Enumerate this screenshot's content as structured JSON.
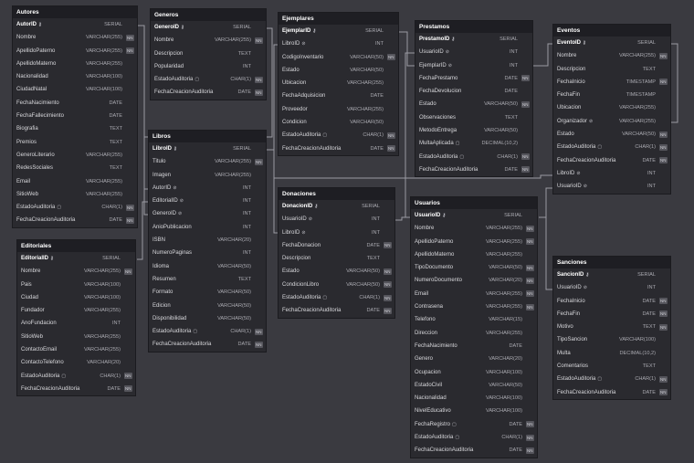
{
  "tables": [
    {
      "id": "autores",
      "title": "Autores",
      "cols": [
        {
          "n": "AutorID",
          "t": "SERIAL",
          "pk": true,
          "icon": "key-icon"
        },
        {
          "n": "Nombre",
          "t": "VARCHAR(255)",
          "nn": true
        },
        {
          "n": "ApellidoPaterno",
          "t": "VARCHAR(255)",
          "nn": true
        },
        {
          "n": "ApellidoMaterno",
          "t": "VARCHAR(255)"
        },
        {
          "n": "Nacionalidad",
          "t": "VARCHAR(100)"
        },
        {
          "n": "CiudadNatal",
          "t": "VARCHAR(100)"
        },
        {
          "n": "FechaNacimiento",
          "t": "DATE"
        },
        {
          "n": "FechaFallecimiento",
          "t": "DATE"
        },
        {
          "n": "Biografia",
          "t": "TEXT"
        },
        {
          "n": "Premios",
          "t": "TEXT"
        },
        {
          "n": "GeneroLiterario",
          "t": "VARCHAR(255)"
        },
        {
          "n": "RedesSociales",
          "t": "TEXT"
        },
        {
          "n": "Email",
          "t": "VARCHAR(255)"
        },
        {
          "n": "SitioWeb",
          "t": "VARCHAR(255)"
        },
        {
          "n": "EstadoAuditoria",
          "t": "CHAR(1)",
          "nn": true,
          "icon": "note-icon"
        },
        {
          "n": "FechaCreacionAuditoria",
          "t": "DATE",
          "nn": true
        }
      ]
    },
    {
      "id": "editoriales",
      "title": "Editoriales",
      "cols": [
        {
          "n": "EditorialID",
          "t": "SERIAL",
          "pk": true,
          "icon": "key-icon"
        },
        {
          "n": "Nombre",
          "t": "VARCHAR(255)",
          "nn": true
        },
        {
          "n": "Pais",
          "t": "VARCHAR(100)"
        },
        {
          "n": "Ciudad",
          "t": "VARCHAR(100)"
        },
        {
          "n": "Fundador",
          "t": "VARCHAR(255)"
        },
        {
          "n": "AnoFundacion",
          "t": "INT"
        },
        {
          "n": "SitioWeb",
          "t": "VARCHAR(255)"
        },
        {
          "n": "ContactoEmail",
          "t": "VARCHAR(255)"
        },
        {
          "n": "ContactoTelefono",
          "t": "VARCHAR(20)"
        },
        {
          "n": "EstadoAuditoria",
          "t": "CHAR(1)",
          "nn": true,
          "icon": "note-icon"
        },
        {
          "n": "FechaCreacionAuditoria",
          "t": "DATE",
          "nn": true
        }
      ]
    },
    {
      "id": "generos",
      "title": "Generos",
      "cols": [
        {
          "n": "GeneroID",
          "t": "SERIAL",
          "pk": true,
          "icon": "key-icon"
        },
        {
          "n": "Nombre",
          "t": "VARCHAR(255)",
          "nn": true
        },
        {
          "n": "Descripcion",
          "t": "TEXT"
        },
        {
          "n": "Popularidad",
          "t": "INT"
        },
        {
          "n": "EstadoAuditoria",
          "t": "CHAR(1)",
          "nn": true,
          "icon": "note-icon"
        },
        {
          "n": "FechaCreacionAuditoria",
          "t": "DATE",
          "nn": true
        }
      ]
    },
    {
      "id": "libros",
      "title": "Libros",
      "cols": [
        {
          "n": "LibroID",
          "t": "SERIAL",
          "pk": true,
          "icon": "key-icon"
        },
        {
          "n": "Titulo",
          "t": "VARCHAR(255)",
          "nn": true
        },
        {
          "n": "Imagen",
          "t": "VARCHAR(255)"
        },
        {
          "n": "AutorID",
          "t": "INT",
          "icon": "link-icon"
        },
        {
          "n": "EditorialID",
          "t": "INT",
          "icon": "link-icon"
        },
        {
          "n": "GeneroID",
          "t": "INT",
          "icon": "link-icon"
        },
        {
          "n": "AnioPublicacion",
          "t": "INT"
        },
        {
          "n": "ISBN",
          "t": "VARCHAR(20)"
        },
        {
          "n": "NumeroPaginas",
          "t": "INT"
        },
        {
          "n": "Idioma",
          "t": "VARCHAR(50)"
        },
        {
          "n": "Resumen",
          "t": "TEXT"
        },
        {
          "n": "Formato",
          "t": "VARCHAR(50)"
        },
        {
          "n": "Edicion",
          "t": "VARCHAR(50)"
        },
        {
          "n": "Disponibilidad",
          "t": "VARCHAR(50)"
        },
        {
          "n": "EstadoAuditoria",
          "t": "CHAR(1)",
          "nn": true,
          "icon": "note-icon"
        },
        {
          "n": "FechaCreacionAuditoria",
          "t": "DATE",
          "nn": true
        }
      ]
    },
    {
      "id": "ejemplares",
      "title": "Ejemplares",
      "cols": [
        {
          "n": "EjemplarID",
          "t": "SERIAL",
          "pk": true,
          "icon": "key-icon"
        },
        {
          "n": "LibroID",
          "t": "INT",
          "icon": "link-icon"
        },
        {
          "n": "CodigoInventario",
          "t": "VARCHAR(50)",
          "nn": true
        },
        {
          "n": "Estado",
          "t": "VARCHAR(50)"
        },
        {
          "n": "Ubicacion",
          "t": "VARCHAR(255)"
        },
        {
          "n": "FechaAdquisicion",
          "t": "DATE"
        },
        {
          "n": "Proveedor",
          "t": "VARCHAR(255)"
        },
        {
          "n": "Condicion",
          "t": "VARCHAR(50)"
        },
        {
          "n": "EstadoAuditoria",
          "t": "CHAR(1)",
          "nn": true,
          "icon": "note-icon"
        },
        {
          "n": "FechaCreacionAuditoria",
          "t": "DATE",
          "nn": true
        }
      ]
    },
    {
      "id": "donaciones",
      "title": "Donaciones",
      "cols": [
        {
          "n": "DonacionID",
          "t": "SERIAL",
          "pk": true,
          "icon": "key-icon"
        },
        {
          "n": "UsuarioID",
          "t": "INT",
          "icon": "link-icon"
        },
        {
          "n": "LibroID",
          "t": "INT",
          "icon": "link-icon"
        },
        {
          "n": "FechaDonacion",
          "t": "DATE",
          "nn": true
        },
        {
          "n": "Descripcion",
          "t": "TEXT"
        },
        {
          "n": "Estado",
          "t": "VARCHAR(50)",
          "nn": true
        },
        {
          "n": "CondicionLibro",
          "t": "VARCHAR(50)",
          "nn": true
        },
        {
          "n": "EstadoAuditoria",
          "t": "CHAR(1)",
          "nn": true,
          "icon": "note-icon"
        },
        {
          "n": "FechaCreacionAuditoria",
          "t": "DATE",
          "nn": true
        }
      ]
    },
    {
      "id": "prestamos",
      "title": "Prestamos",
      "cols": [
        {
          "n": "PrestamoID",
          "t": "SERIAL",
          "pk": true,
          "icon": "key-icon"
        },
        {
          "n": "UsuarioID",
          "t": "INT",
          "icon": "link-icon"
        },
        {
          "n": "EjemplarID",
          "t": "INT",
          "icon": "link-icon"
        },
        {
          "n": "FechaPrestamo",
          "t": "DATE",
          "nn": true
        },
        {
          "n": "FechaDevolucion",
          "t": "DATE"
        },
        {
          "n": "Estado",
          "t": "VARCHAR(50)",
          "nn": true
        },
        {
          "n": "Observaciones",
          "t": "TEXT"
        },
        {
          "n": "MetodoEntrega",
          "t": "VARCHAR(50)"
        },
        {
          "n": "MultaAplicada",
          "t": "DECIMAL(10,2)",
          "icon": "note-icon"
        },
        {
          "n": "EstadoAuditoria",
          "t": "CHAR(1)",
          "nn": true,
          "icon": "note-icon"
        },
        {
          "n": "FechaCreacionAuditoria",
          "t": "DATE",
          "nn": true
        }
      ]
    },
    {
      "id": "usuarios",
      "title": "Usuarios",
      "cols": [
        {
          "n": "UsuarioID",
          "t": "SERIAL",
          "pk": true,
          "icon": "key-icon"
        },
        {
          "n": "Nombre",
          "t": "VARCHAR(255)",
          "nn": true
        },
        {
          "n": "ApellidoPaterno",
          "t": "VARCHAR(255)",
          "nn": true
        },
        {
          "n": "ApellidoMaterno",
          "t": "VARCHAR(255)"
        },
        {
          "n": "TipoDocumento",
          "t": "VARCHAR(50)",
          "nn": true
        },
        {
          "n": "NumeroDocumento",
          "t": "VARCHAR(20)",
          "nn": true
        },
        {
          "n": "Email",
          "t": "VARCHAR(255)",
          "nn": true
        },
        {
          "n": "Contrasena",
          "t": "VARCHAR(255)",
          "nn": true
        },
        {
          "n": "Telefono",
          "t": "VARCHAR(15)"
        },
        {
          "n": "Direccion",
          "t": "VARCHAR(255)"
        },
        {
          "n": "FechaNacimiento",
          "t": "DATE"
        },
        {
          "n": "Genero",
          "t": "VARCHAR(20)"
        },
        {
          "n": "Ocupacion",
          "t": "VARCHAR(100)"
        },
        {
          "n": "EstadoCivil",
          "t": "VARCHAR(50)"
        },
        {
          "n": "Nacionalidad",
          "t": "VARCHAR(100)"
        },
        {
          "n": "NivelEducativo",
          "t": "VARCHAR(100)"
        },
        {
          "n": "FechaRegistro",
          "t": "DATE",
          "nn": true,
          "icon": "note-icon"
        },
        {
          "n": "EstadoAuditoria",
          "t": "CHAR(1)",
          "nn": true,
          "icon": "note-icon"
        },
        {
          "n": "FechaCreacionAuditoria",
          "t": "DATE",
          "nn": true
        }
      ]
    },
    {
      "id": "eventos",
      "title": "Eventos",
      "cols": [
        {
          "n": "EventoID",
          "t": "SERIAL",
          "pk": true,
          "icon": "key-icon"
        },
        {
          "n": "Nombre",
          "t": "VARCHAR(255)",
          "nn": true
        },
        {
          "n": "Descripcion",
          "t": "TEXT"
        },
        {
          "n": "FechaInicio",
          "t": "TIMESTAMP",
          "nn": true
        },
        {
          "n": "FechaFin",
          "t": "TIMESTAMP"
        },
        {
          "n": "Ubicacion",
          "t": "VARCHAR(255)"
        },
        {
          "n": "Organizador",
          "t": "VARCHAR(255)",
          "icon": "link-icon"
        },
        {
          "n": "Estado",
          "t": "VARCHAR(50)",
          "nn": true
        },
        {
          "n": "EstadoAuditoria",
          "t": "CHAR(1)",
          "nn": true,
          "icon": "note-icon"
        },
        {
          "n": "FechaCreacionAuditoria",
          "t": "DATE",
          "nn": true
        },
        {
          "n": "LibroID",
          "t": "INT",
          "icon": "link-icon"
        },
        {
          "n": "UsuarioID",
          "t": "INT",
          "icon": "link-icon"
        }
      ]
    },
    {
      "id": "sanciones",
      "title": "Sanciones",
      "cols": [
        {
          "n": "SancionID",
          "t": "SERIAL",
          "pk": true,
          "icon": "key-icon"
        },
        {
          "n": "UsuarioID",
          "t": "INT",
          "icon": "link-icon"
        },
        {
          "n": "FechaInicio",
          "t": "DATE",
          "nn": true
        },
        {
          "n": "FechaFin",
          "t": "DATE",
          "nn": true
        },
        {
          "n": "Motivo",
          "t": "TEXT",
          "nn": true
        },
        {
          "n": "TipoSancion",
          "t": "VARCHAR(100)"
        },
        {
          "n": "Multa",
          "t": "DECIMAL(10,2)"
        },
        {
          "n": "Comentarios",
          "t": "TEXT"
        },
        {
          "n": "EstadoAuditoria",
          "t": "CHAR(1)",
          "nn": true,
          "icon": "note-icon"
        },
        {
          "n": "FechaCreacionAuditoria",
          "t": "DATE",
          "nn": true
        }
      ]
    }
  ],
  "nn_label": "NN",
  "colors": {
    "background": "#3a3a40",
    "table": "#2a2a2f",
    "header": "#1e1e23",
    "connector": "#9a9aa2"
  }
}
